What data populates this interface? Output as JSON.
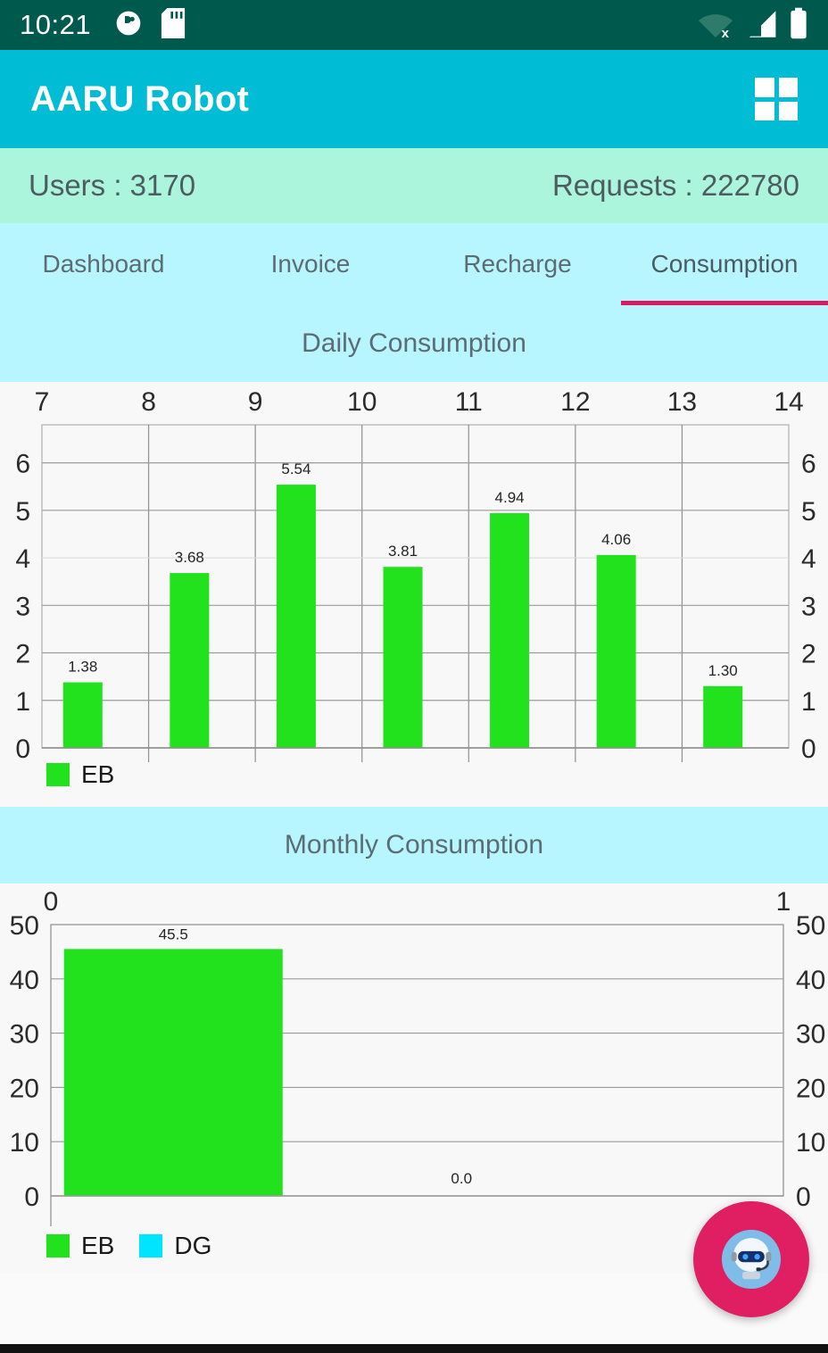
{
  "status_bar": {
    "time": "10:21",
    "icons": [
      "app-notification-icon",
      "sd-card-icon"
    ],
    "right_icons": [
      "wifi-off-icon",
      "signal-icon",
      "battery-icon"
    ]
  },
  "app_bar": {
    "title": "AARU Robot",
    "menu_icon": "grid-menu-icon"
  },
  "stats": {
    "users_label": "Users : 3170",
    "requests_label": "Requests : 222780"
  },
  "tabs": {
    "items": [
      {
        "label": "Dashboard",
        "active": false
      },
      {
        "label": "Invoice",
        "active": false
      },
      {
        "label": "Recharge",
        "active": false
      },
      {
        "label": "Consumption",
        "active": true
      }
    ],
    "indicator_color": "#d81b60"
  },
  "daily_section": {
    "title": "Daily Consumption"
  },
  "monthly_section": {
    "title": "Monthly Consumption"
  },
  "fab": {
    "icon": "robot-assistant-icon",
    "color": "#e01f63"
  },
  "colors": {
    "status_bar": "#00594d",
    "app_bar": "#00bcd4",
    "stats_bar": "#abf5dc",
    "tab_bar": "#b7f5ff",
    "eb_series": "#21e21d",
    "dg_series": "#00e5ff",
    "chart_bg": "#f8f8f8",
    "grid": "#c8c8c8"
  },
  "chart_data": [
    {
      "type": "bar",
      "title": "Daily Consumption",
      "xlabel": "",
      "ylabel": "",
      "categories": [
        "7",
        "8",
        "9",
        "10",
        "11",
        "12",
        "13",
        "14"
      ],
      "x_tick_labels": [
        "7",
        "8",
        "9",
        "10",
        "11",
        "12",
        "13",
        "14"
      ],
      "x_axis_position": "top",
      "series": [
        {
          "name": "EB",
          "color": "#21e21d",
          "values": [
            1.38,
            3.68,
            5.54,
            3.81,
            4.94,
            4.06,
            1.3
          ]
        }
      ],
      "bar_labels": [
        "1.38",
        "3.68",
        "5.54",
        "3.81",
        "4.94",
        "4.06",
        "1.30"
      ],
      "ylim": [
        0,
        6.8
      ],
      "y_ticks": [
        0,
        1,
        2,
        3,
        4,
        5,
        6
      ],
      "y_tick_labels_left": [
        "0",
        "1",
        "2",
        "3",
        "4",
        "5",
        "6"
      ],
      "y_tick_labels_right": [
        "0",
        "1",
        "2",
        "3",
        "4",
        "5",
        "6"
      ],
      "grid": true,
      "legend": [
        {
          "label": "EB",
          "color": "#21e21d"
        }
      ],
      "legend_position": "bottom-left"
    },
    {
      "type": "bar",
      "title": "Monthly Consumption",
      "xlabel": "",
      "ylabel": "",
      "categories": [
        "0",
        "1"
      ],
      "x_tick_labels": [
        "0",
        "1"
      ],
      "x_axis_position": "top",
      "series": [
        {
          "name": "EB",
          "color": "#21e21d",
          "values": [
            45.5
          ]
        },
        {
          "name": "DG",
          "color": "#00e5ff",
          "values": [
            0.0
          ]
        }
      ],
      "bar_labels": [
        "45.5",
        "0.0"
      ],
      "ylim": [
        0,
        50
      ],
      "y_ticks": [
        0,
        10,
        20,
        30,
        40,
        50
      ],
      "y_tick_labels_left": [
        "0",
        "10",
        "20",
        "30",
        "40",
        "50"
      ],
      "y_tick_labels_right": [
        "0",
        "10",
        "20",
        "30",
        "40",
        "50"
      ],
      "grid": true,
      "legend": [
        {
          "label": "EB",
          "color": "#21e21d"
        },
        {
          "label": "DG",
          "color": "#00e5ff"
        }
      ],
      "legend_position": "bottom-left"
    }
  ]
}
